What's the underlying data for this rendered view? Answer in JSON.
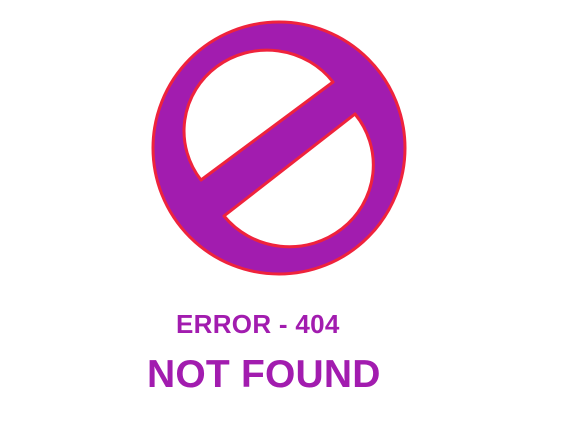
{
  "colors": {
    "background": "#ffffff",
    "sign_fill": "#a21caf",
    "sign_outline": "#ef233c",
    "text": "#a21caf"
  },
  "icon": {
    "name": "prohibited-icon"
  },
  "error": {
    "code_text": "ERROR - 404",
    "message": "NOT FOUND"
  }
}
